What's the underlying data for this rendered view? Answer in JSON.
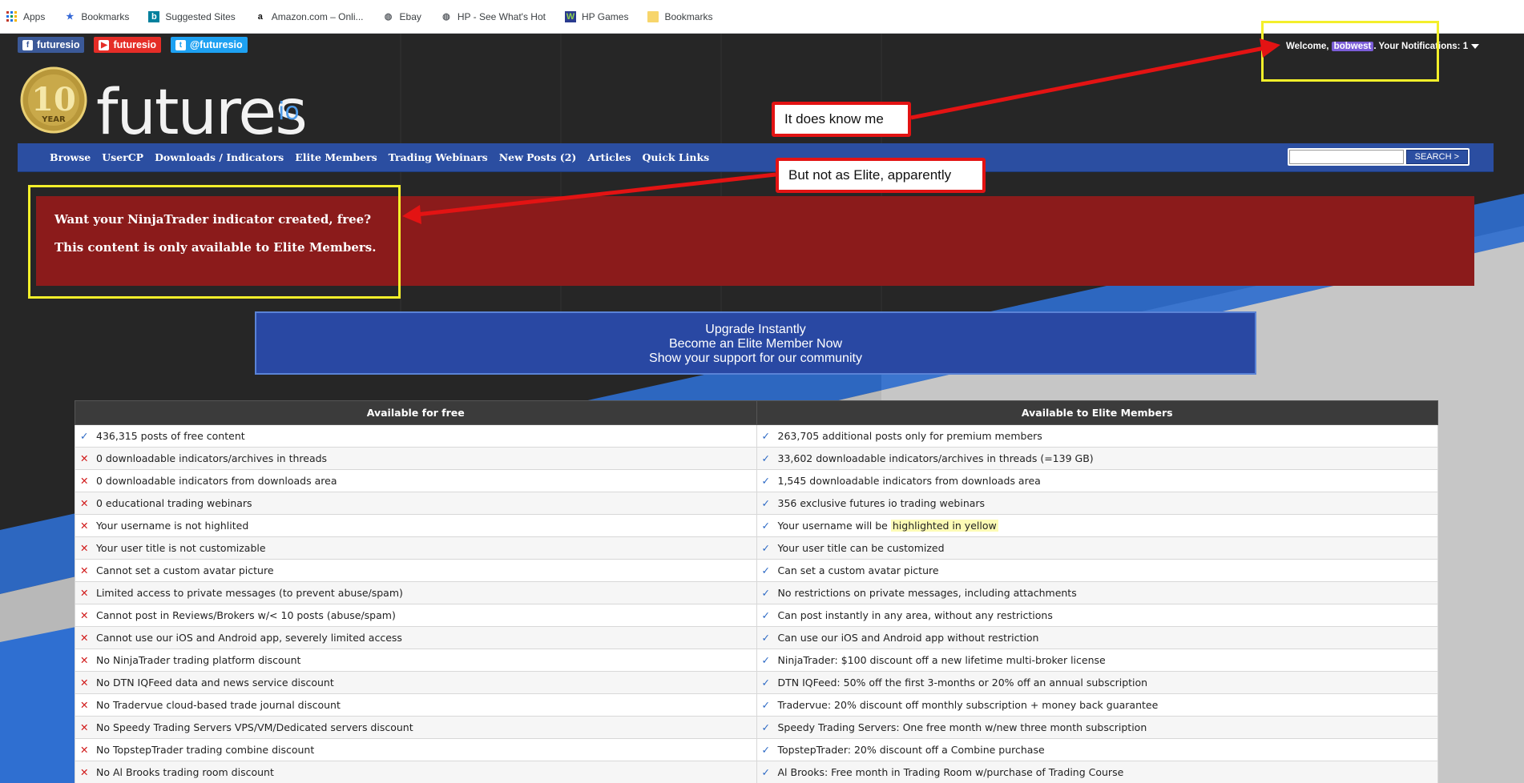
{
  "bookmarks": [
    {
      "label": "Apps",
      "icon": "apps-grid-icon"
    },
    {
      "label": "Bookmarks",
      "icon": "star-icon"
    },
    {
      "label": "Suggested Sites",
      "icon": "bing-icon"
    },
    {
      "label": "Amazon.com – Onli...",
      "icon": "amazon-icon"
    },
    {
      "label": "Ebay",
      "icon": "globe-icon"
    },
    {
      "label": "HP - See What's Hot",
      "icon": "globe-icon"
    },
    {
      "label": "HP Games",
      "icon": "hp-games-icon"
    },
    {
      "label": "Bookmarks",
      "icon": "folder-icon"
    }
  ],
  "social": [
    {
      "label": "futuresio",
      "icon": "facebook-icon",
      "color": "#3b5998"
    },
    {
      "label": "futuresio",
      "icon": "youtube-icon",
      "color": "#e52d27"
    },
    {
      "label": "@futuresio",
      "icon": "twitter-icon",
      "color": "#1da1f2"
    }
  ],
  "welcome": {
    "prefix": "Welcome, ",
    "username": "bobwest",
    "suffix": ". Your Notifications: 1"
  },
  "logo": {
    "badge_top": "10",
    "badge_bottom": "YEAR",
    "text": "futures",
    "sub": "io"
  },
  "nav": {
    "items": [
      "Browse",
      "UserCP",
      "Downloads / Indicators",
      "Elite Members",
      "Trading Webinars",
      "New Posts (2)",
      "Articles",
      "Quick Links"
    ],
    "search_placeholder": "",
    "search_button": "SEARCH  >"
  },
  "banner": {
    "line1": "Want your NinjaTrader indicator created, free?",
    "line2": "This content is only available to Elite Members."
  },
  "upgrade": {
    "line1": "Upgrade Instantly",
    "line2": "Become an Elite Member Now",
    "line3": "Show your support for our community"
  },
  "table": {
    "headers": [
      "Available for free",
      "Available to Elite Members"
    ],
    "rows": [
      {
        "free": "436,315 posts of free content",
        "free_ok": true,
        "elite": "263,705 additional posts only for premium members"
      },
      {
        "free": "0 downloadable indicators/archives in threads",
        "free_ok": false,
        "elite": "33,602 downloadable indicators/archives in threads (=139 GB)"
      },
      {
        "free": "0 downloadable indicators from downloads area",
        "free_ok": false,
        "elite": "1,545 downloadable indicators from downloads area"
      },
      {
        "free": "0 educational trading webinars",
        "free_ok": false,
        "elite": "356 exclusive futures io trading webinars"
      },
      {
        "free": "Your username is not highlited",
        "free_ok": false,
        "elite": "Your username will be",
        "elite_highlight": "highlighted in yellow"
      },
      {
        "free": "Your user title is not customizable",
        "free_ok": false,
        "elite": "Your user title can be customized"
      },
      {
        "free": "Cannot set a custom avatar picture",
        "free_ok": false,
        "elite": "Can set a custom avatar picture"
      },
      {
        "free": "Limited access to private messages (to prevent abuse/spam)",
        "free_ok": false,
        "elite": "No restrictions on private messages, including attachments"
      },
      {
        "free": "Cannot post in Reviews/Brokers w/< 10 posts (abuse/spam)",
        "free_ok": false,
        "elite": "Can post instantly in any area, without any restrictions"
      },
      {
        "free": "Cannot use our iOS and Android app, severely limited access",
        "free_ok": false,
        "elite": "Can use our iOS and Android app without restriction"
      },
      {
        "free": "No NinjaTrader trading platform discount",
        "free_ok": false,
        "elite": "NinjaTrader: $100 discount off a new lifetime multi-broker license"
      },
      {
        "free": "No DTN IQFeed data and news service discount",
        "free_ok": false,
        "elite": "DTN IQFeed: 50% off the first 3-months or 20% off an annual subscription"
      },
      {
        "free": "No Tradervue cloud-based trade journal discount",
        "free_ok": false,
        "elite": "Tradervue: 20% discount off monthly subscription + money back guarantee"
      },
      {
        "free": "No Speedy Trading Servers VPS/VM/Dedicated servers discount",
        "free_ok": false,
        "elite": "Speedy Trading Servers: One free month w/new three month subscription"
      },
      {
        "free": "No TopstepTrader trading combine discount",
        "free_ok": false,
        "elite": "TopstepTrader: 20% discount off a Combine purchase"
      },
      {
        "free": "No Al Brooks trading room discount",
        "free_ok": false,
        "elite": "Al Brooks: Free month in Trading Room w/purchase of Trading Course"
      }
    ]
  },
  "annotations": {
    "callout1": "It does know me",
    "callout2": "But not as Elite, apparently"
  },
  "colors": {
    "nav_blue": "#2b4ea1",
    "banner_red": "#8b1b1b",
    "annotation_yellow": "#f3ef2a",
    "annotation_red": "#e31313",
    "check_blue": "#2866c4",
    "cross_red": "#d01818"
  }
}
